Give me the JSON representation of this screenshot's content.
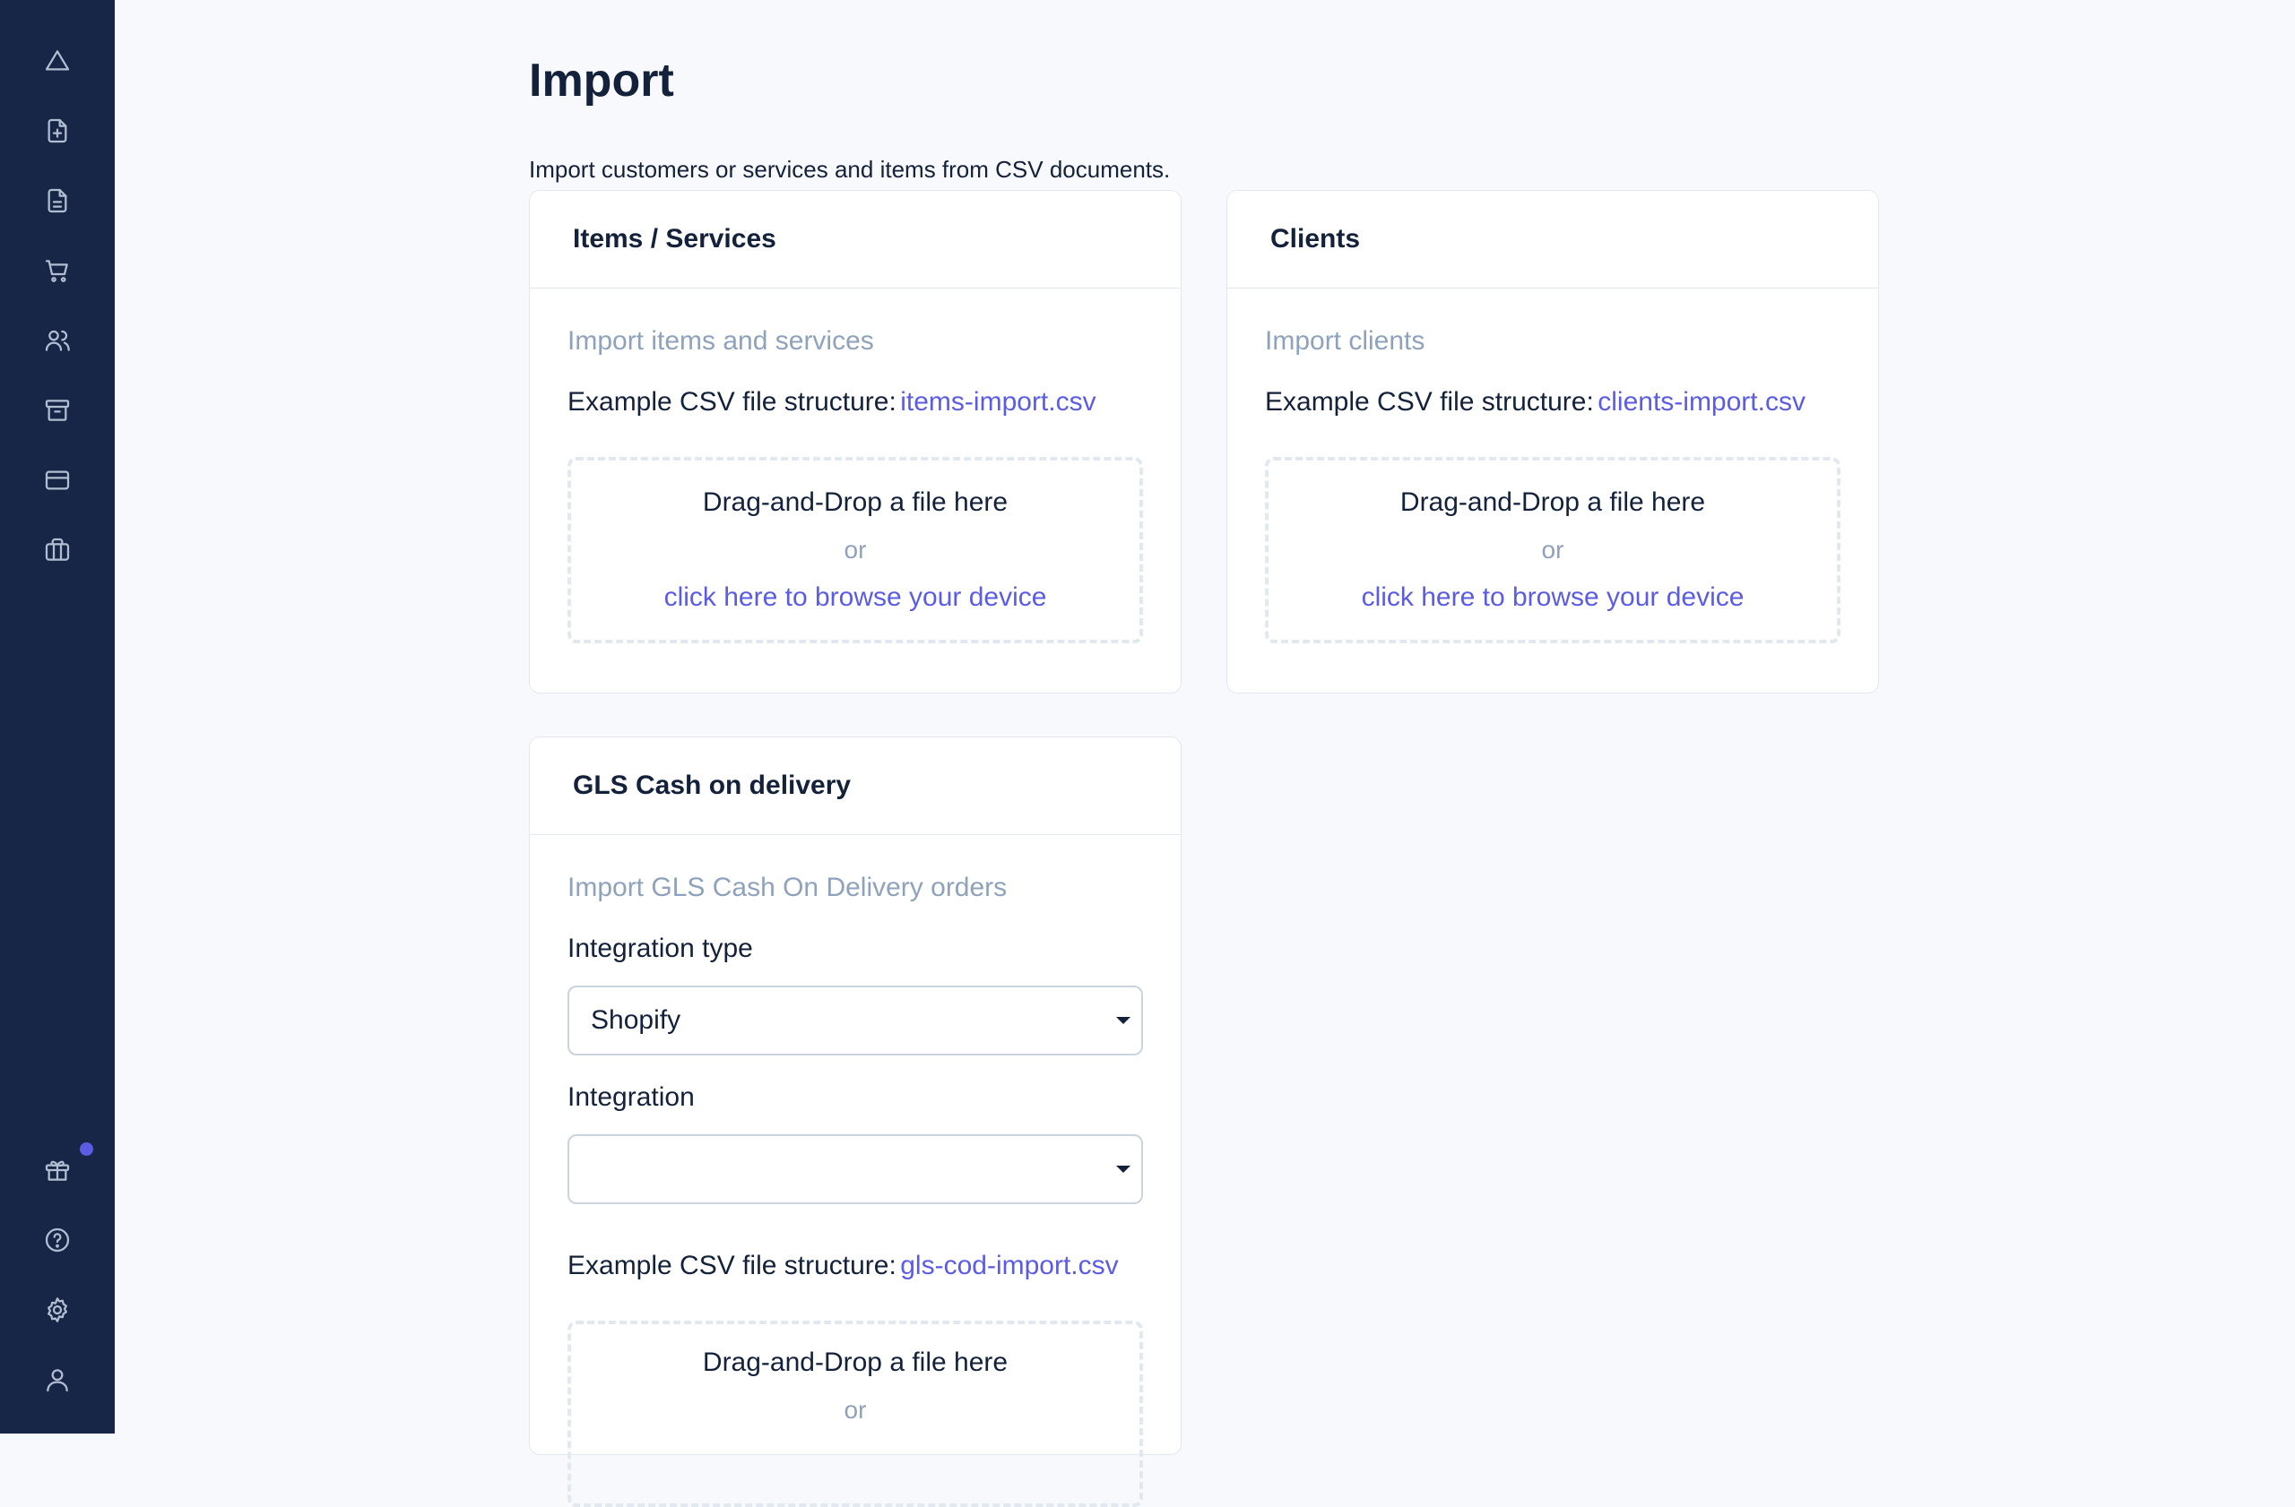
{
  "sidebar": {
    "top_icons": [
      "home-triangle-icon",
      "file-plus-icon",
      "file-icon",
      "cart-icon",
      "users-icon",
      "archive-icon",
      "credit-card-icon",
      "briefcase-icon"
    ],
    "bottom_icons": [
      "gift-icon",
      "help-icon",
      "settings-icon",
      "user-icon"
    ],
    "notification_color": "#5b5ce6"
  },
  "page": {
    "title": "Import",
    "subtitle": "Import customers or services and items from CSV documents."
  },
  "items_card": {
    "title": "Items / Services",
    "description": "Import items and services",
    "example_label": "Example CSV file structure:",
    "example_file": "items-import.csv",
    "drop_text": "Drag-and-Drop a file here",
    "or_text": "or",
    "browse_text": "click here to browse your device"
  },
  "clients_card": {
    "title": "Clients",
    "description": "Import clients",
    "example_label": "Example CSV file structure:",
    "example_file": "clients-import.csv",
    "drop_text": "Drag-and-Drop a file here",
    "or_text": "or",
    "browse_text": "click here to browse your device"
  },
  "gls_card": {
    "title": "GLS Cash on delivery",
    "description": "Import GLS Cash On Delivery orders",
    "integration_type_label": "Integration type",
    "integration_type_value": "Shopify",
    "integration_label": "Integration",
    "integration_value": "",
    "example_label": "Example CSV file structure:",
    "example_file": "gls-cod-import.csv",
    "drop_text": "Drag-and-Drop a file here",
    "or_text": "or"
  },
  "colors": {
    "sidebar_bg": "#172646",
    "accent": "#5b5ce6",
    "muted": "#8fa2bb",
    "background": "#f8f9fc"
  }
}
